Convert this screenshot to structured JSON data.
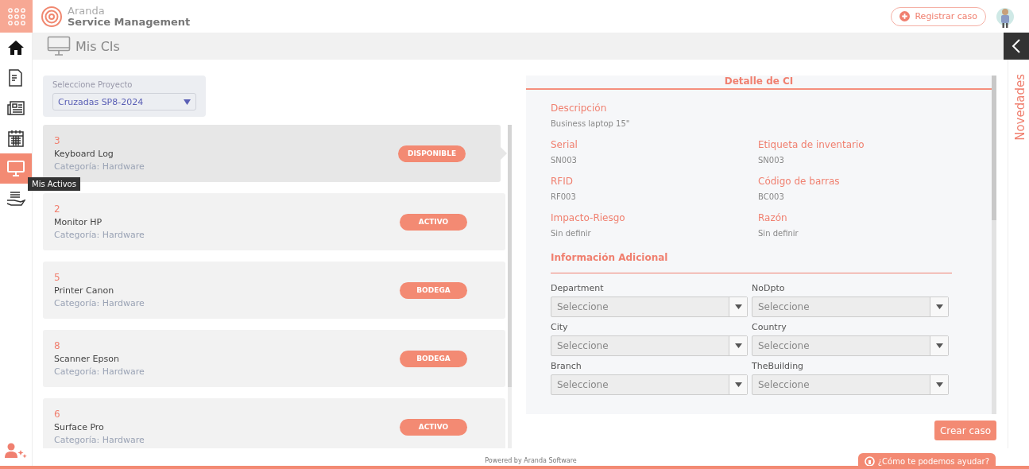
{
  "brand": {
    "line1": "Aranda",
    "line2": "Service Management"
  },
  "register_button": "Registrar caso",
  "nav": [
    {
      "selected": false
    },
    {
      "selected": false
    },
    {
      "selected": false
    },
    {
      "selected": false
    },
    {
      "selected": true
    },
    {
      "selected": false
    }
  ],
  "tooltip": "Mis Activos",
  "page_title": "Mis CIs",
  "project": {
    "label": "Seleccione Proyecto",
    "value": "Cruzadas SP8-2024"
  },
  "items": [
    {
      "id": "3",
      "name": "Keyboard Log",
      "category": "Categoría: Hardware",
      "status": "DISPONIBLE",
      "selected": true
    },
    {
      "id": "2",
      "name": "Monitor HP",
      "category": "Categoría: Hardware",
      "status": "ACTIVO",
      "selected": false
    },
    {
      "id": "5",
      "name": "Printer Canon",
      "category": "Categoría: Hardware",
      "status": "BODEGA",
      "selected": false
    },
    {
      "id": "8",
      "name": "Scanner Epson",
      "category": "Categoría: Hardware",
      "status": "BODEGA",
      "selected": false
    },
    {
      "id": "6",
      "name": "Surface Pro",
      "category": "Categoría: Hardware",
      "status": "ACTIVO",
      "selected": false
    }
  ],
  "detail": {
    "title": "Detalle de CI",
    "description": {
      "label": "Descripción",
      "value": "Business laptop 15\""
    },
    "fields": [
      {
        "label": "Serial",
        "value": "SN003"
      },
      {
        "label": "Etiqueta de inventario",
        "value": "SN003"
      },
      {
        "label": "RFID",
        "value": "RF003"
      },
      {
        "label": "Código de barras",
        "value": "BC003"
      },
      {
        "label": "Impacto-Riesgo",
        "value": "Sin definir"
      },
      {
        "label": "Razón",
        "value": "Sin definir"
      }
    ],
    "additional_title": "Información Adicional",
    "selects": [
      {
        "label": "Department",
        "placeholder": "Seleccione"
      },
      {
        "label": "NoDpto",
        "placeholder": "Seleccione"
      },
      {
        "label": "City",
        "placeholder": "Seleccione"
      },
      {
        "label": "Country",
        "placeholder": "Seleccione"
      },
      {
        "label": "Branch",
        "placeholder": "Seleccione"
      },
      {
        "label": "TheBuilding",
        "placeholder": "Seleccione"
      }
    ]
  },
  "create_button": "Crear caso",
  "news_tab": "Novedades",
  "footer": "Powered by Aranda Software",
  "help_button": "¿Cómo te podemos ayudar?"
}
